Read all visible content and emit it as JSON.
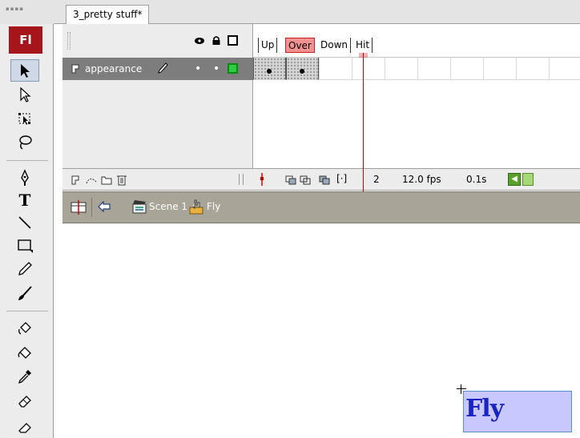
{
  "app": {
    "logo": "Fl",
    "document_tab": "3_pretty stuff*"
  },
  "tools": [
    {
      "name": "selection-tool",
      "icon": "arrow-icon",
      "selected": true
    },
    {
      "name": "subselection-tool",
      "icon": "white-arrow-icon"
    },
    {
      "name": "free-transform-tool",
      "icon": "free-transform-icon"
    },
    {
      "name": "lasso-tool",
      "icon": "lasso-icon"
    },
    {
      "name": "pen-tool",
      "icon": "pen-icon"
    },
    {
      "name": "text-tool",
      "icon": "text-icon",
      "glyph": "T"
    },
    {
      "name": "line-tool",
      "icon": "line-icon"
    },
    {
      "name": "rectangle-tool",
      "icon": "rectangle-icon"
    },
    {
      "name": "pencil-tool",
      "icon": "pencil-icon"
    },
    {
      "name": "brush-tool",
      "icon": "brush-icon"
    },
    {
      "name": "ink-bottle-tool",
      "icon": "ink-bottle-icon"
    },
    {
      "name": "paint-bucket-tool",
      "icon": "paint-bucket-icon"
    },
    {
      "name": "eyedropper-tool",
      "icon": "eyedropper-icon"
    },
    {
      "name": "eraser-tool",
      "icon": "eraser-icon"
    }
  ],
  "timeline": {
    "header_icons": [
      "eye-icon",
      "lock-icon",
      "outline-icon"
    ],
    "frame_labels": [
      "Up",
      "Over",
      "Down",
      "Hit"
    ],
    "current_frame_label": "Over",
    "layer": {
      "name": "appearance",
      "outline_color": "#2ecc40"
    },
    "status": {
      "current_frame": "2",
      "frame_rate": "12.0 fps",
      "elapsed": "0.1s"
    }
  },
  "edit_bar": {
    "scene": "Scene 1",
    "symbol": "Fly"
  },
  "stage": {
    "button_text": "Fly",
    "button_fill": "#c8c8ff",
    "text_color": "#1a24c6"
  },
  "colors": {
    "logo_red": "#a5151b",
    "playhead_red": "#cc0000",
    "over_label_fill": "#f29191"
  }
}
